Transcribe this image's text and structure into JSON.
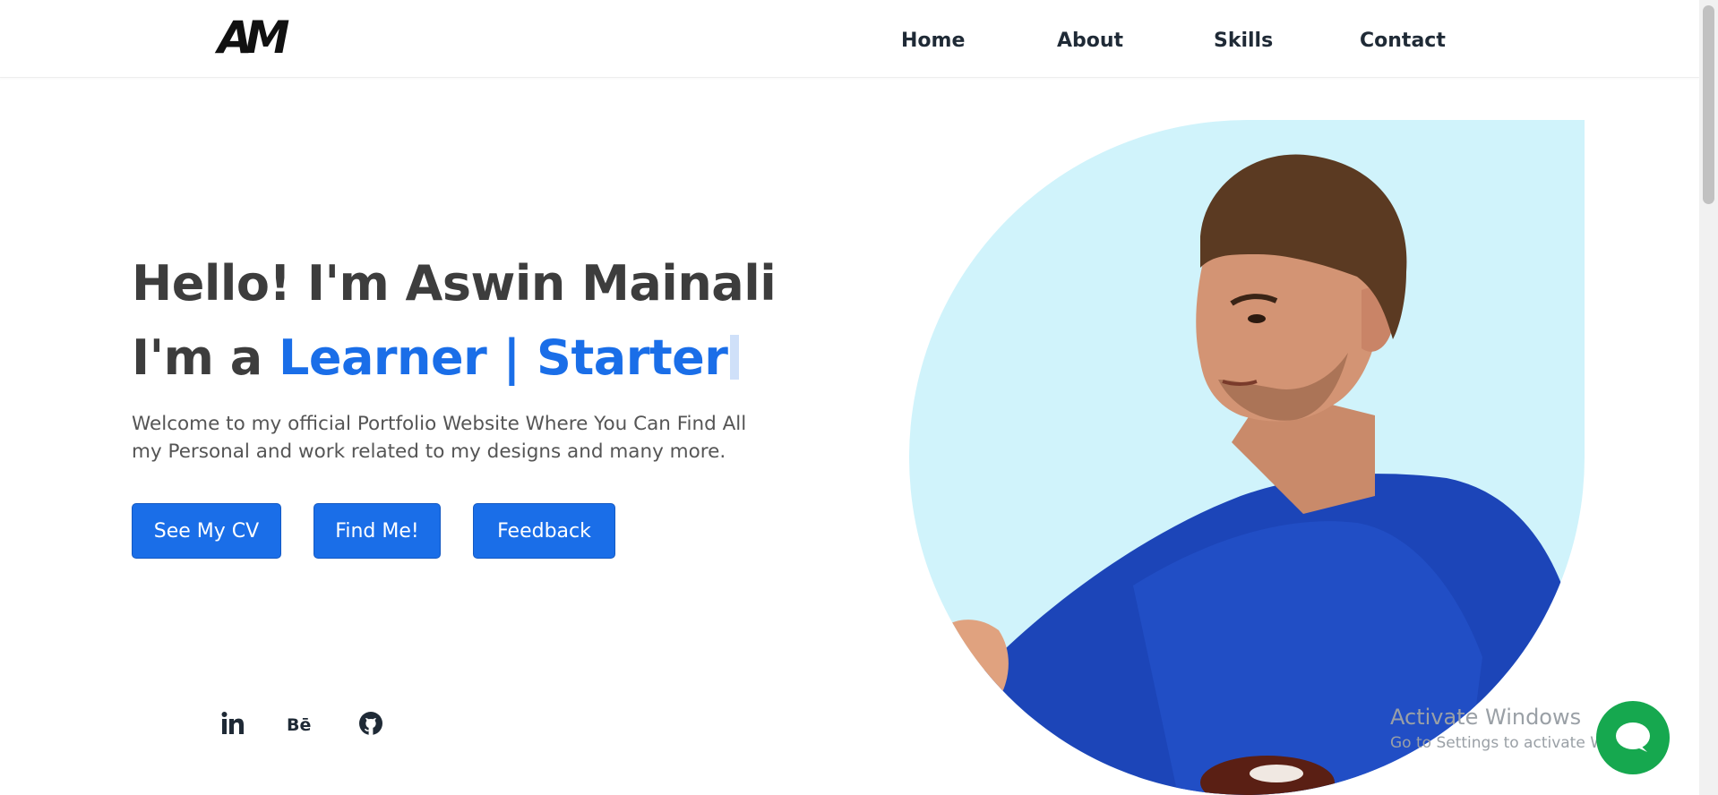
{
  "header": {
    "logo": "AM",
    "nav": [
      "Home",
      "About",
      "Skills",
      "Contact"
    ]
  },
  "hero": {
    "greeting": "Hello! I'm Aswin Mainali",
    "role_prefix": "I'm a ",
    "role_words": "Learner | Starter",
    "description": "Welcome to my official Portfolio Website Where You Can Find All my Personal and work related to my designs and many more.",
    "buttons": [
      "See My CV",
      "Find Me!",
      "Feedback"
    ]
  },
  "social": [
    "linkedin-icon",
    "behance-icon",
    "github-icon"
  ],
  "watermark": {
    "title": "Activate Windows",
    "subtitle": "Go to Settings to activate Windows."
  },
  "colors": {
    "accent": "#1a6ee8",
    "heading": "#3d3d3d",
    "portrait_bg": "#d0f3fb",
    "chat": "#16a84f"
  }
}
